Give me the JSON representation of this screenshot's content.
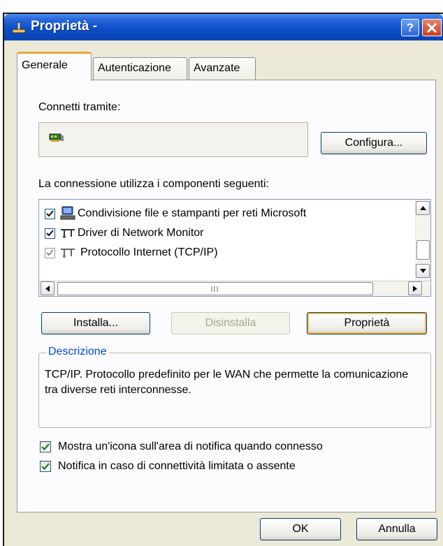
{
  "window": {
    "title": "Proprietà -",
    "help_label": "?"
  },
  "tabs": [
    {
      "label": "Generale"
    },
    {
      "label": "Autenticazione"
    },
    {
      "label": "Avanzate"
    }
  ],
  "general": {
    "connect_label": "Connetti tramite:",
    "configure_button": "Configura...",
    "components_label": "La connessione utilizza i componenti seguenti:",
    "components": [
      {
        "label": "Condivisione file e stampanti per reti Microsoft",
        "checked": true,
        "icon": "computer-network-icon"
      },
      {
        "label": "Driver di Network Monitor",
        "checked": true,
        "icon": "network-protocol-icon"
      },
      {
        "label": "Protocollo Internet (TCP/IP)",
        "checked": true,
        "disabled": true,
        "icon": "network-protocol-icon"
      }
    ],
    "install_button": "Installa...",
    "uninstall_button": "Disinstalla",
    "properties_button": "Proprietà",
    "description_title": "Descrizione",
    "description_text": "TCP/IP. Protocollo predefinito per le WAN che permette la comunicazione tra diverse reti interconnesse.",
    "option_notify_icon": "Mostra un'icona sull'area di notifica quando connesso",
    "option_notify_limited": "Notifica in caso di connettività limitata o assente"
  },
  "footer": {
    "ok_button": "OK",
    "cancel_button": "Annulla"
  },
  "colors": {
    "titlebar": "#0d4fc9",
    "dialog_bg": "#ece9d8",
    "group_title": "#0046d5",
    "focus_ring": "#f8b848"
  }
}
